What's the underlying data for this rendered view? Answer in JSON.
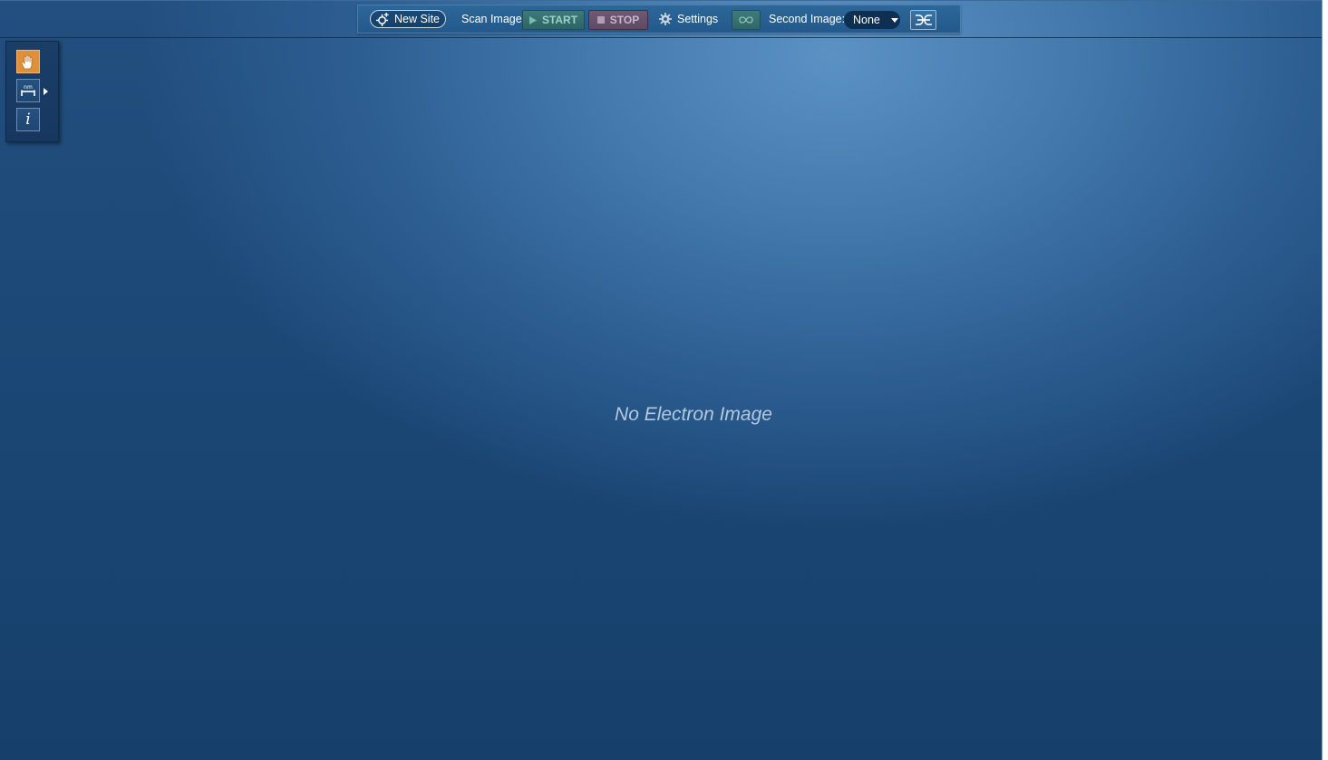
{
  "toolbar": {
    "new_site_label": "New Site",
    "scan_image_label": "Scan Image",
    "start_label": "START",
    "stop_label": "STOP",
    "settings_label": "Settings",
    "second_image_label": "Second Image:",
    "second_image_value": "None",
    "icons": {
      "new_site": "new-site-icon",
      "start": "play-icon",
      "stop": "stop-icon",
      "settings": "gear-icon",
      "loop": "infinity-icon",
      "align": "align-images-icon"
    }
  },
  "tool_palette": {
    "tools": [
      {
        "name": "pan",
        "icon": "hand-icon",
        "selected": true
      },
      {
        "name": "measure",
        "icon": "ruler-icon",
        "has_submenu": true
      },
      {
        "name": "info",
        "label": "i",
        "icon": "info-icon"
      }
    ]
  },
  "viewer": {
    "empty_message": "No Electron Image"
  },
  "colors": {
    "accent_tool": "#e0903a",
    "start_button": "#3c7a7c",
    "stop_button": "#6e5a73",
    "background": "#1a4674"
  }
}
